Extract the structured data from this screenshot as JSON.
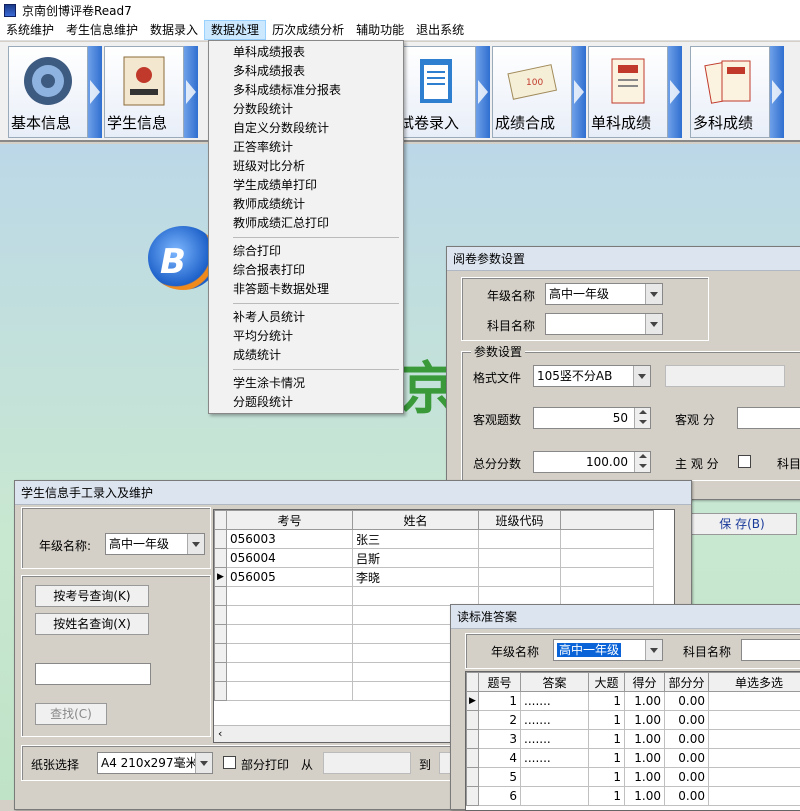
{
  "app": {
    "title": "京南创博评卷Read7"
  },
  "menubar": [
    "系统维护",
    "考生信息维护",
    "数据录入",
    "数据处理",
    "历次成绩分析",
    "辅助功能",
    "退出系统"
  ],
  "toolbar": {
    "buttons": [
      {
        "label": "基本信息",
        "icon": "gear-icon"
      },
      {
        "label": "学生信息",
        "icon": "contacts-book-icon"
      },
      {
        "label": "试卷录入",
        "icon": "clipboard-icon"
      },
      {
        "label": "成绩合成",
        "icon": "score-card-icon"
      },
      {
        "label": "单科成绩",
        "icon": "certificate-icon"
      },
      {
        "label": "多科成绩",
        "icon": "stacked-certificates-icon"
      }
    ]
  },
  "background": {
    "logo_text": "B",
    "big_char": "京"
  },
  "dropdown": {
    "groups": [
      [
        "单科成绩报表",
        "多科成绩报表",
        "多科成绩标准分报表",
        "分数段统计",
        "自定义分数段统计",
        "正答率统计",
        "班级对比分析",
        "学生成绩单打印",
        "教师成绩统计",
        "教师成绩汇总打印"
      ],
      [
        "综合打印",
        "综合报表打印",
        "非答题卡数据处理"
      ],
      [
        "补考人员统计",
        "平均分统计",
        "成绩统计"
      ],
      [
        "学生涂卡情况",
        "分题段统计"
      ]
    ]
  },
  "param_win": {
    "title": "阅卷参数设置",
    "grade_label": "年级名称",
    "grade_value": "高中一年级",
    "subject_label": "科目名称",
    "subject_value": "",
    "group_label": "参数设置",
    "format_label": "格式文件",
    "format_value": "105竖不分AB",
    "objective_count_label": "客观题数",
    "objective_count_value": "50",
    "objective_score_label": "客观 分",
    "total_label": "总分分数",
    "total_value": "100.00",
    "subjective_label": "主 观 分",
    "subject_short": "科目",
    "save_label": "保 存(B)"
  },
  "student_win": {
    "title": "学生信息手工录入及维护",
    "grade_label": "年级名称:",
    "grade_value": "高中一年级",
    "btn_by_id": "按考号查询(K)",
    "btn_by_name": "按姓名查询(X)",
    "btn_find": "查找(C)",
    "search_value": "",
    "columns": [
      "考号",
      "姓名",
      "班级代码"
    ],
    "rows": [
      [
        "056003",
        "张三",
        ""
      ],
      [
        "056004",
        "吕斯",
        ""
      ],
      [
        "056005",
        "李晓",
        ""
      ]
    ],
    "paper_label": "纸张选择",
    "paper_value": "A4 210x297毫米",
    "partial_label": "部分打印",
    "from_label": "从",
    "to_label": "到"
  },
  "answer_win": {
    "title": "读标准答案",
    "grade_label": "年级名称",
    "grade_value": "高中一年级",
    "subject_label": "科目名称",
    "columns": [
      "题号",
      "答案",
      "大题",
      "得分",
      "部分分",
      "单选多选"
    ],
    "rows": [
      [
        "1",
        ".......",
        "1",
        "1.00",
        "0.00",
        ""
      ],
      [
        "2",
        ".......",
        "1",
        "1.00",
        "0.00",
        ""
      ],
      [
        "3",
        ".......",
        "1",
        "1.00",
        "0.00",
        ""
      ],
      [
        "4",
        ".......",
        "1",
        "1.00",
        "0.00",
        ""
      ],
      [
        "5",
        "",
        "1",
        "1.00",
        "0.00",
        ""
      ],
      [
        "6",
        "",
        "1",
        "1.00",
        "0.00",
        ""
      ]
    ]
  }
}
